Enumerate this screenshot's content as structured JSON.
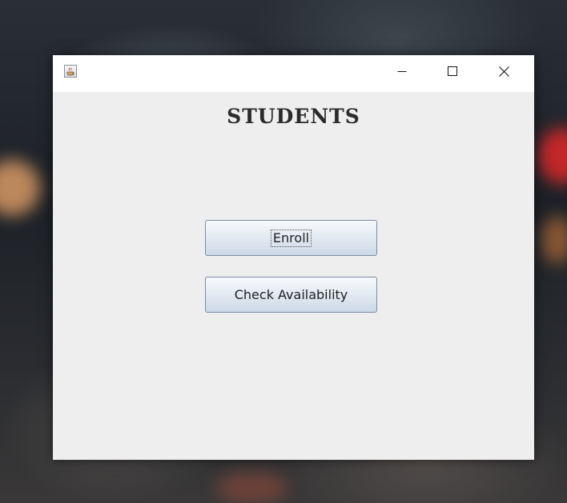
{
  "window": {
    "controls": {
      "minimize_icon": "minimize-icon",
      "maximize_icon": "maximize-icon",
      "close_icon": "close-icon"
    },
    "app_icon": "java-cup-icon"
  },
  "content": {
    "heading": "STUDENTS",
    "buttons": {
      "enroll_label": "Enroll",
      "check_label": "Check Availability"
    }
  },
  "colors": {
    "window_background": "#eeeeee",
    "titlebar_background": "#ffffff",
    "button_border": "#7a8ca6"
  }
}
